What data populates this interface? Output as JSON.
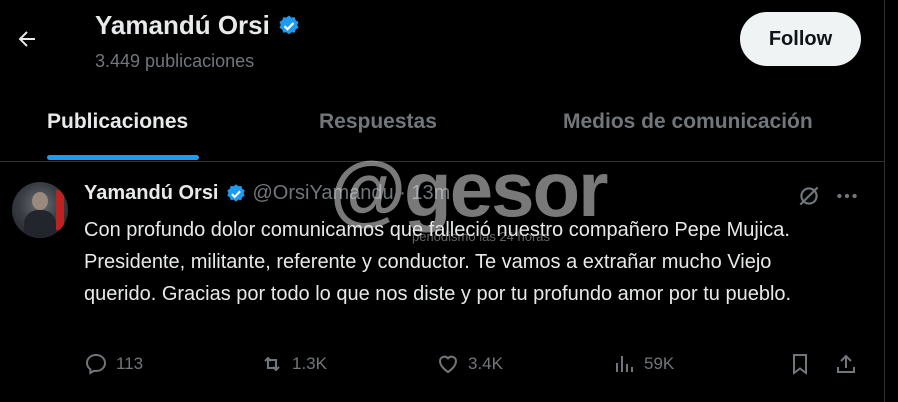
{
  "header": {
    "name": "Yamandú Orsi",
    "post_count": "3.449 publicaciones",
    "follow_label": "Follow"
  },
  "tabs": [
    {
      "label": "Publicaciones"
    },
    {
      "label": "Respuestas"
    },
    {
      "label": "Medios de comunicación"
    }
  ],
  "tweet": {
    "name": "Yamandú Orsi",
    "handle": "@OrsiYamandu · 13m",
    "text": "Con profundo dolor comunicamos que falleció nuestro compañero Pepe Mujica. Presidente, militante, referente y conductor. Te vamos a extrañar mucho Viejo querido. Gracias por todo lo que nos diste y por tu profundo amor por tu pueblo.",
    "replies": "113",
    "reposts": "1.3K",
    "likes": "3.4K",
    "views": "59K"
  },
  "watermark": {
    "text": "@gesor",
    "subtext": "periodismo las 24 horas"
  },
  "colors": {
    "accent": "#1d9bf0",
    "background": "#000000",
    "muted": "#71767b"
  },
  "icons": [
    "back-arrow-icon",
    "verified-badge-icon",
    "grok-icon",
    "more-icon",
    "reply-icon",
    "repost-icon",
    "like-icon",
    "views-icon",
    "bookmark-icon",
    "share-icon"
  ]
}
